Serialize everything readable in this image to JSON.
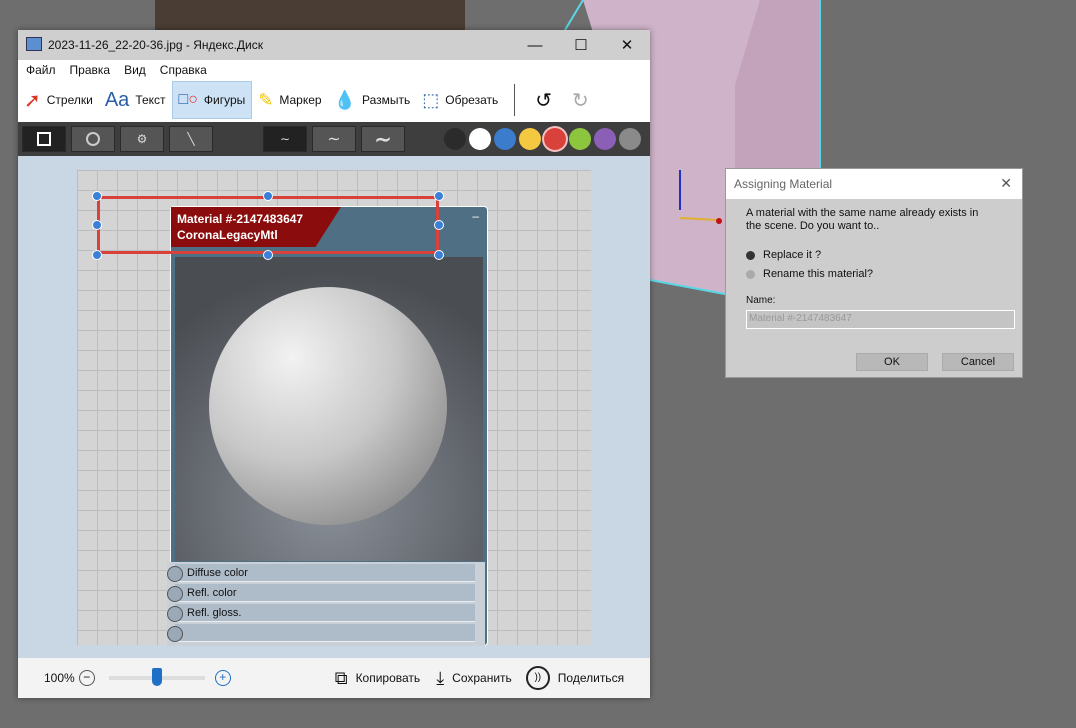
{
  "window": {
    "title": "2023-11-26_22-20-36.jpg - Яндекс.Диск",
    "minimize": "—",
    "maximize": "☐",
    "close": "✕"
  },
  "menu": [
    "Файл",
    "Правка",
    "Вид",
    "Справка"
  ],
  "toolbar": [
    {
      "label": "Стрелки",
      "icon": "arrow-icon"
    },
    {
      "label": "Текст",
      "icon": "text-icon"
    },
    {
      "label": "Фигуры",
      "icon": "shapes-icon",
      "selected": true
    },
    {
      "label": "Маркер",
      "icon": "marker-icon"
    },
    {
      "label": "Размыть",
      "icon": "blur-icon"
    },
    {
      "label": "Обрезать",
      "icon": "crop-icon"
    }
  ],
  "shape_colors": [
    "#2b2b2b",
    "#ffffff",
    "#3b7ccc",
    "#f5c842",
    "#d9423b",
    "#8cc63f",
    "#8a5fb5",
    "#8a8a8a"
  ],
  "selected_color": "#d9423b",
  "node": {
    "title": "Material #-2147483647",
    "subtitle": "CoronaLegacyMtl",
    "collapse": "–",
    "slots": [
      "Diffuse color",
      "Refl. color",
      "Refl. gloss."
    ]
  },
  "bottom": {
    "zoom": "100%",
    "zoom_level": 0.5,
    "copy": "Копировать",
    "save": "Сохранить",
    "share": "Поделиться"
  },
  "dialog": {
    "title": "Assigning Material",
    "message": "A  material with the same name already exists in the scene. Do you want to..",
    "option1": "Replace it ?",
    "option2": "Rename this material?",
    "name_label": "Name:",
    "name_value": "Material #-2147483647",
    "ok": "OK",
    "cancel": "Cancel",
    "close": "✕"
  }
}
